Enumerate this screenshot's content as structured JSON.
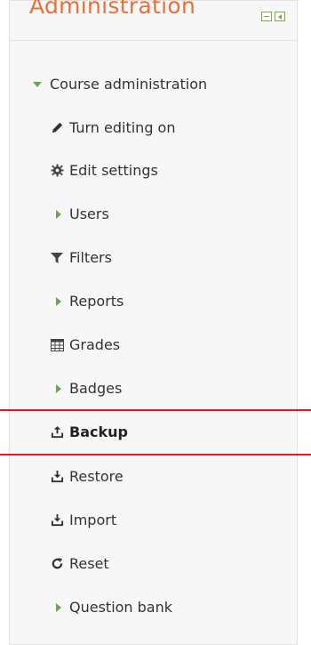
{
  "block": {
    "title": "Administration"
  },
  "menu": {
    "course_admin": "Course administration",
    "turn_editing_on": "Turn editing on",
    "edit_settings": "Edit settings",
    "users": "Users",
    "filters": "Filters",
    "reports": "Reports",
    "grades": "Grades",
    "badges": "Badges",
    "backup": "Backup",
    "restore": "Restore",
    "import": "Import",
    "reset": "Reset",
    "question_bank": "Question bank"
  },
  "colors": {
    "title": "#e8703a",
    "expand_arrow": "#6aa84f",
    "highlight": "#e01b24"
  }
}
